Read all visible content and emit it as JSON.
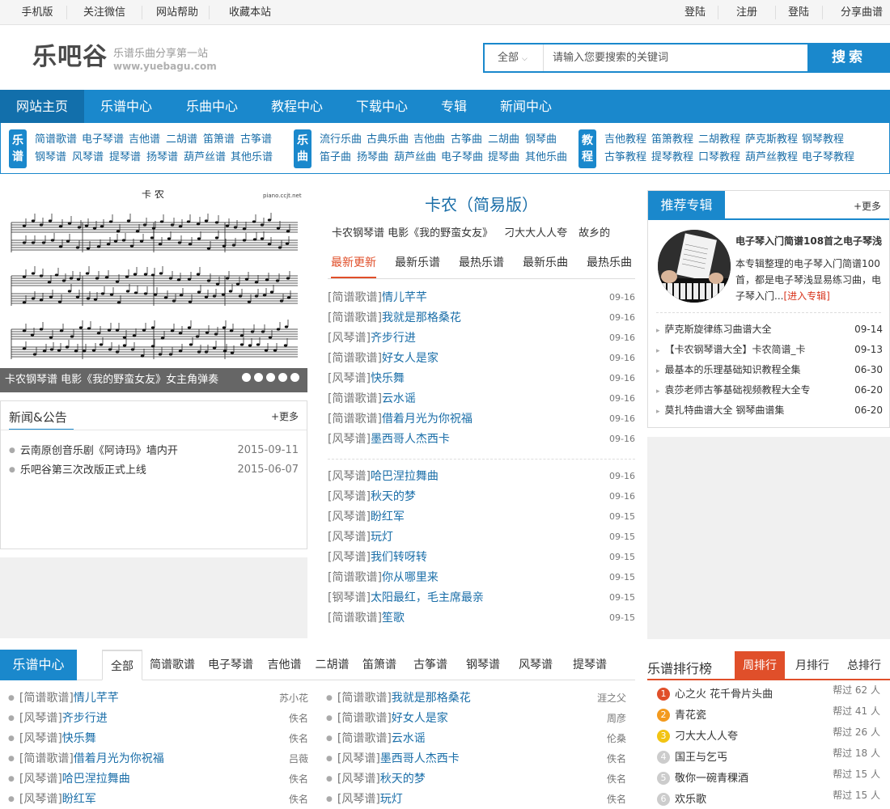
{
  "topbar": {
    "left": [
      "手机版",
      "关注微信",
      "网站帮助",
      "收藏本站"
    ],
    "right": [
      "登陆",
      "注册",
      "登陆",
      "分享曲谱"
    ]
  },
  "header": {
    "logo": "乐吧谷",
    "slogan": "乐谱乐曲分享第一站",
    "url": "www.yuebagu.com",
    "search_select": "全部",
    "search_placeholder": "请输入您要搜索的关键词",
    "search_button": "搜索"
  },
  "nav": [
    "网站主页",
    "乐谱中心",
    "乐曲中心",
    "教程中心",
    "下载中心",
    "专辑",
    "新闻中心"
  ],
  "subnav": {
    "groups": [
      {
        "badge": "乐谱",
        "row1": [
          "简谱歌谱",
          "电子琴谱",
          "吉他谱",
          "二胡谱",
          "笛箫谱",
          "古筝谱"
        ],
        "row2": [
          "钢琴谱",
          "风琴谱",
          "提琴谱",
          "扬琴谱",
          "葫芦丝谱",
          "其他乐谱"
        ]
      },
      {
        "badge": "乐曲",
        "row1": [
          "流行乐曲",
          "古典乐曲",
          "吉他曲",
          "古筝曲",
          "二胡曲",
          "钢琴曲"
        ],
        "row2": [
          "笛子曲",
          "扬琴曲",
          "葫芦丝曲",
          "电子琴曲",
          "提琴曲",
          "其他乐曲"
        ]
      },
      {
        "badge": "教程",
        "row1": [
          "吉他教程",
          "笛箫教程",
          "二胡教程",
          "萨克斯教程",
          "钢琴教程"
        ],
        "row2": [
          "古筝教程",
          "提琴教程",
          "口琴教程",
          "葫芦丝教程",
          "电子琴教程"
        ]
      }
    ]
  },
  "slide": {
    "caption": "卡农钢琴谱 电影《我的野蛮女友》女主角弹奏",
    "sheet_title": "卡 农",
    "sheet_site": "piano.ccjt.net",
    "dots": 5
  },
  "news": {
    "title": "新闻&公告",
    "more": "+更多",
    "items": [
      {
        "text": "云南原创音乐剧《阿诗玛》墙内开",
        "date": "2015-09-11"
      },
      {
        "text": "乐吧谷第三次改版正式上线",
        "date": "2015-06-07"
      }
    ]
  },
  "center": {
    "title": "卡农（简易版）",
    "subtitle": [
      "卡农钢琴谱 电影《我的野蛮女友》",
      "刁大大人人夸",
      "故乡的"
    ],
    "tabs": [
      "最新更新",
      "最新乐谱",
      "最热乐谱",
      "最新乐曲",
      "最热乐曲"
    ],
    "list1": [
      {
        "cat": "[简谱歌谱]",
        "name": "情儿芊芊",
        "date": "09-16"
      },
      {
        "cat": "[简谱歌谱]",
        "name": "我就是那格桑花",
        "date": "09-16"
      },
      {
        "cat": "[风琴谱]",
        "name": "齐步行进",
        "date": "09-16"
      },
      {
        "cat": "[简谱歌谱]",
        "name": "好女人是家",
        "date": "09-16"
      },
      {
        "cat": "[风琴谱]",
        "name": "快乐舞",
        "date": "09-16"
      },
      {
        "cat": "[简谱歌谱]",
        "name": "云水谣",
        "date": "09-16"
      },
      {
        "cat": "[简谱歌谱]",
        "name": "借着月光为你祝福",
        "date": "09-16"
      },
      {
        "cat": "[风琴谱]",
        "name": "墨西哥人杰西卡",
        "date": "09-16"
      }
    ],
    "list2": [
      {
        "cat": "[风琴谱]",
        "name": "哈巴涅拉舞曲",
        "date": "09-16"
      },
      {
        "cat": "[风琴谱]",
        "name": "秋天的梦",
        "date": "09-16"
      },
      {
        "cat": "[风琴谱]",
        "name": "盼红军",
        "date": "09-15"
      },
      {
        "cat": "[风琴谱]",
        "name": "玩灯",
        "date": "09-15"
      },
      {
        "cat": "[风琴谱]",
        "name": "我们转呀转",
        "date": "09-15"
      },
      {
        "cat": "[简谱歌谱]",
        "name": "你从哪里来",
        "date": "09-15"
      },
      {
        "cat": "[钢琴谱]",
        "name": "太阳最红，毛主席最亲",
        "date": "09-15"
      },
      {
        "cat": "[简谱歌谱]",
        "name": "笙歌",
        "date": "09-15"
      }
    ]
  },
  "album": {
    "title": "推荐专辑",
    "more": "+更多",
    "name": "电子琴入门简谱108首之电子琴浅",
    "desc": "本专辑整理的电子琴入门简谱100首，都是电子琴浅显易练习曲，电子琴入门...",
    "enter": "[进入专辑]",
    "items": [
      {
        "text": "萨克斯旋律练习曲谱大全",
        "date": "09-14"
      },
      {
        "text": "【卡农钢琴谱大全】卡农简谱_卡",
        "date": "09-13"
      },
      {
        "text": "最基本的乐理基础知识教程全集",
        "date": "06-30"
      },
      {
        "text": "袁莎老师古筝基础视频教程大全专",
        "date": "06-20"
      },
      {
        "text": "莫扎特曲谱大全 钢琴曲谱集",
        "date": "06-20"
      }
    ]
  },
  "score_center": {
    "title": "乐谱中心",
    "tabs": [
      "全部",
      "简谱歌谱",
      "电子琴谱",
      "吉他谱",
      "二胡谱",
      "笛箫谱",
      "古筝谱",
      "钢琴谱",
      "风琴谱",
      "提琴谱"
    ],
    "left": [
      {
        "cat": "[简谱歌谱]",
        "name": "情儿芊芊",
        "author": "苏小花"
      },
      {
        "cat": "[风琴谱]",
        "name": "齐步行进",
        "author": "佚名"
      },
      {
        "cat": "[风琴谱]",
        "name": "快乐舞",
        "author": "佚名"
      },
      {
        "cat": "[简谱歌谱]",
        "name": "借着月光为你祝福",
        "author": "吕薇"
      },
      {
        "cat": "[风琴谱]",
        "name": "哈巴涅拉舞曲",
        "author": "佚名"
      },
      {
        "cat": "[风琴谱]",
        "name": "盼红军",
        "author": "佚名"
      }
    ],
    "right": [
      {
        "cat": "[简谱歌谱]",
        "name": "我就是那格桑花",
        "author": "涯之父"
      },
      {
        "cat": "[简谱歌谱]",
        "name": "好女人是家",
        "author": "周彦"
      },
      {
        "cat": "[简谱歌谱]",
        "name": "云水谣",
        "author": "伦桑"
      },
      {
        "cat": "[风琴谱]",
        "name": "墨西哥人杰西卡",
        "author": "佚名"
      },
      {
        "cat": "[风琴谱]",
        "name": "秋天的梦",
        "author": "佚名"
      },
      {
        "cat": "[风琴谱]",
        "name": "玩灯",
        "author": "佚名"
      }
    ]
  },
  "ranking": {
    "title": "乐谱排行榜",
    "tabs": [
      "周排行",
      "月排行",
      "总排行"
    ],
    "colors": [
      "#e04f2a",
      "#f39a1e",
      "#f2c413",
      "#cccccc",
      "#cccccc",
      "#cccccc"
    ],
    "items": [
      {
        "num": "1",
        "name": "心之火 花千骨片头曲",
        "count": "帮过 62 人"
      },
      {
        "num": "2",
        "name": "青花瓷",
        "count": "帮过 41 人"
      },
      {
        "num": "3",
        "name": "刁大大人人夸",
        "count": "帮过 26 人"
      },
      {
        "num": "4",
        "name": "国王与乞丐",
        "count": "帮过 18 人"
      },
      {
        "num": "5",
        "name": "敬你一碗青稞酒",
        "count": "帮过 15 人"
      },
      {
        "num": "6",
        "name": "欢乐歌",
        "count": "帮过 15 人"
      }
    ]
  }
}
